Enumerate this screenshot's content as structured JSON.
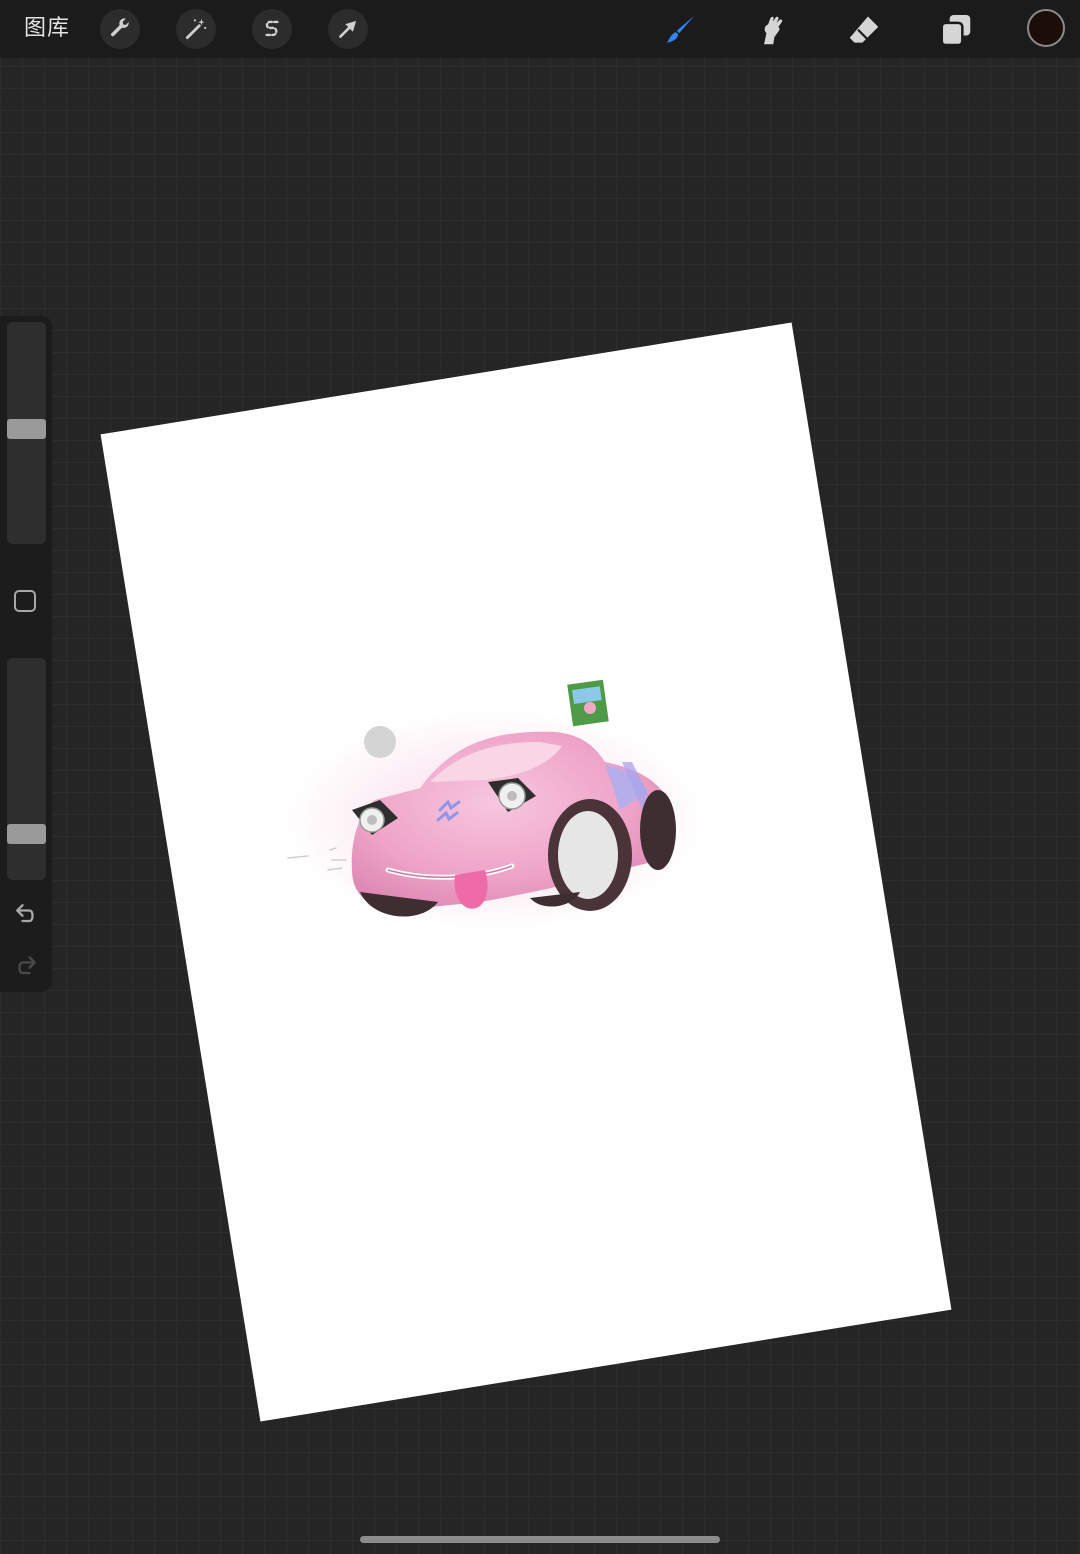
{
  "toolbar": {
    "gallery_label": "图库",
    "left_tools": [
      {
        "name": "actions",
        "icon": "wrench-icon"
      },
      {
        "name": "adjustments",
        "icon": "magic-wand-icon"
      },
      {
        "name": "selection",
        "icon": "selection-s-icon"
      },
      {
        "name": "transform",
        "icon": "arrow-cursor-icon"
      }
    ],
    "right_tools": [
      {
        "name": "brush",
        "icon": "brush-icon",
        "active": true
      },
      {
        "name": "smudge",
        "icon": "smudge-icon"
      },
      {
        "name": "eraser",
        "icon": "eraser-icon"
      },
      {
        "name": "layers",
        "icon": "layers-icon"
      }
    ],
    "active_color": "#1c0d08",
    "accent_color": "#2f86ff"
  },
  "sidebar": {
    "brush_size_level": 0.48,
    "opacity_level": 0.82,
    "modify_icon": "square-icon",
    "undo_icon": "undo-icon",
    "redo_icon": "redo-icon"
  },
  "canvas": {
    "background": "#ffffff",
    "artwork": "pink-cartoon-car"
  }
}
